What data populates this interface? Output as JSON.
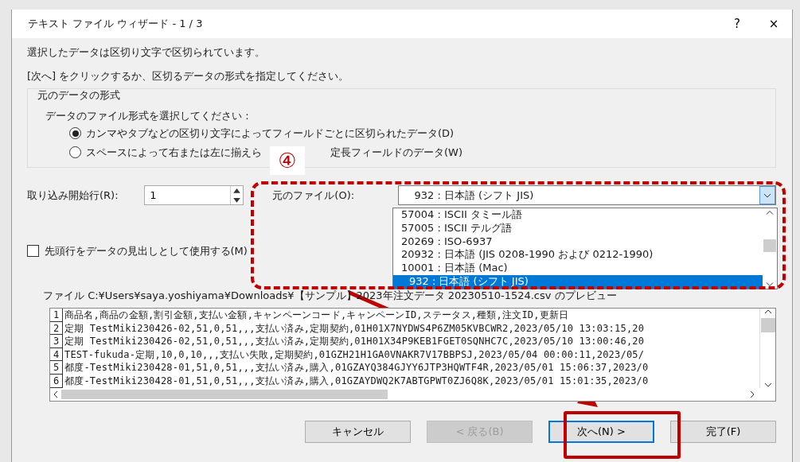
{
  "window": {
    "title": "テキスト ファイル ウィザード - 1 / 3",
    "help": "?",
    "close": "×"
  },
  "intro": [
    "選択したデータは区切り文字で区切られています。",
    "[次へ] をクリックするか、区切るデータの形式を指定してください。"
  ],
  "group": {
    "title": "元のデータの形式",
    "prompt": "データのファイル形式を選択してください :",
    "options": [
      {
        "text": "カンマやタブなどの区切り文字によってフィールドごとに区切られたデータ(D)",
        "selected": true
      },
      {
        "text": "スペースによって右または左に揃えら",
        "text_after": "定長フィールドのデータ(W)",
        "selected": false
      }
    ]
  },
  "start_row": {
    "label": "取り込み開始行(R):",
    "value": "1"
  },
  "origin": {
    "label": "元のファイル(O):",
    "value": "932 : 日本語 (シフト JIS)",
    "list": [
      {
        "text": "57004 : ISCII タミール語",
        "selected": false
      },
      {
        "text": "57005 : ISCII テルグ語",
        "selected": false
      },
      {
        "text": "20269 : ISO-6937",
        "selected": false
      },
      {
        "text": "20932 : 日本語 (JIS 0208-1990 および 0212-1990)",
        "selected": false
      },
      {
        "text": "10001 : 日本語 (Mac)",
        "selected": false
      },
      {
        "text": "932 : 日本語 (シフト JIS)",
        "selected": true
      }
    ]
  },
  "header_checkbox": {
    "label": "先頭行をデータの見出しとして使用する(M)",
    "checked": false
  },
  "preview": {
    "caption": "ファイル C:¥Users¥saya.yoshiyama¥Downloads¥【サンプル】2023年注文データ 20230510-1524.csv のプレビュー",
    "rows": [
      {
        "num": "1",
        "text": "商品名,商品の金額,割引金額,支払い金額,キャンペーンコード,キャンペーンID,ステータス,種類,注文ID,更新日"
      },
      {
        "num": "2",
        "text": "定期 TestMiki230426-02,51,0,51,,,支払い済み,定期契約,01H01X7NYDWS4P6ZM05KVBCWR2,2023/05/10 13:03:15,20"
      },
      {
        "num": "3",
        "text": "定期 TestMiki230426-02,51,0,51,,,支払い済み,定期契約,01H01X34P9KEB1FGET0SQNHC7C,2023/05/10 13:00:46,20"
      },
      {
        "num": "4",
        "text": "TEST-fukuda-定期,10,0,10,,,支払い失敗,定期契約,01GZH21H1GA0VNAKR7V17BBPSJ,2023/05/04 00:00:11,2023/05/"
      },
      {
        "num": "5",
        "text": "都度-TestMiki230428-01,51,0,51,,,支払い済み,購入,01GZAYQ384GJYY6JTP3HQWTF4R,2023/05/01 15:06:37,2023/0"
      },
      {
        "num": "6",
        "text": "都度-TestMiki230428-01,51,0,51,,,支払い済み,購入,01GZAYDWQ2K7ABTGPWT0ZJ6Q8K,2023/05/01 15:01:35,2023/0"
      }
    ]
  },
  "buttons": [
    {
      "label": "キャンセル",
      "disabled": false,
      "focused": false
    },
    {
      "label": "< 戻る(B)",
      "disabled": true,
      "focused": false
    },
    {
      "label": "次へ(N) >",
      "disabled": false,
      "focused": true
    },
    {
      "label": "完了(F)",
      "disabled": false,
      "focused": false
    }
  ],
  "annotation": {
    "marker": "④"
  }
}
